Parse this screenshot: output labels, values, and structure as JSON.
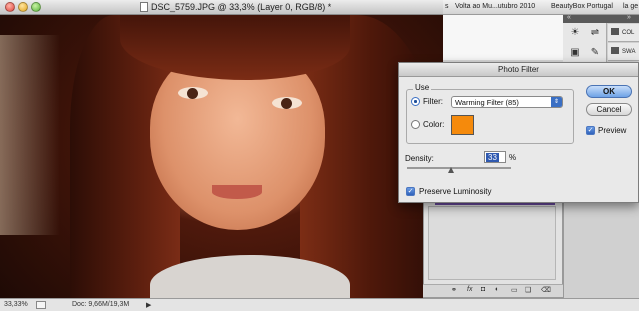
{
  "document": {
    "title": "DSC_5759.JPG @ 33,3% (Layer 0, RGB/8) *",
    "zoom": "33,33%",
    "doc_size": "Doc: 9,66M/19,3M"
  },
  "browser": {
    "tabs": [
      "s",
      "Volta ao Mu...utubro 2010",
      "BeautyBox Portugal",
      "la ge"
    ]
  },
  "dock": {
    "panels": [
      {
        "label": "COL",
        "icon": "color-icon"
      },
      {
        "label": "SWA",
        "icon": "swatches-icon"
      }
    ]
  },
  "dialog": {
    "title": "Photo Filter",
    "use_label": "Use",
    "filter_label": "Filter:",
    "filter_value": "Warming Filter (85)",
    "color_label": "Color:",
    "color_swatch": "#f58a0c",
    "density_label": "Density:",
    "density_value": "33",
    "density_unit": "%",
    "preserve_label": "Preserve Luminosity",
    "preserve_checked": true,
    "ok_label": "OK",
    "cancel_label": "Cancel",
    "preview_label": "Preview",
    "preview_checked": true,
    "filter_selected": true
  }
}
